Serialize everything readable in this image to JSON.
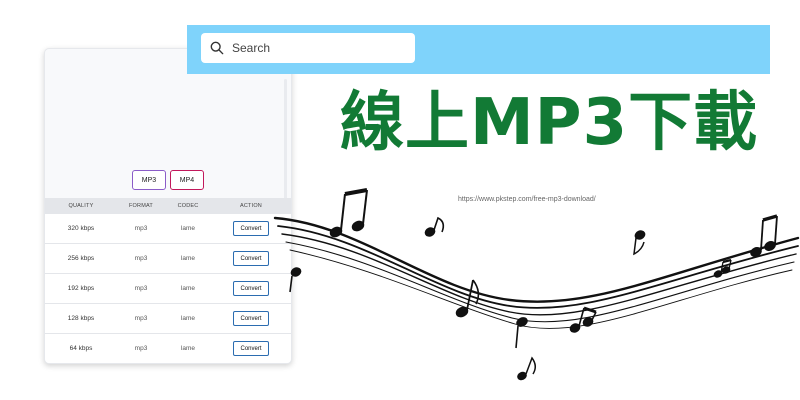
{
  "search": {
    "placeholder": "Search"
  },
  "headline": "線上MP3下載",
  "url": "https://www.pkstep.com/free-mp3-download/",
  "converter": {
    "format_buttons": [
      "MP3",
      "MP4"
    ],
    "columns": [
      "QUALITY",
      "FORMAT",
      "CODEC",
      "ACTION"
    ],
    "rows": [
      {
        "quality": "320 kbps",
        "format": "mp3",
        "codec": "lame",
        "action": "Convert"
      },
      {
        "quality": "256 kbps",
        "format": "mp3",
        "codec": "lame",
        "action": "Convert"
      },
      {
        "quality": "192 kbps",
        "format": "mp3",
        "codec": "lame",
        "action": "Convert"
      },
      {
        "quality": "128 kbps",
        "format": "mp3",
        "codec": "lame",
        "action": "Convert"
      },
      {
        "quality": "64 kbps",
        "format": "mp3",
        "codec": "lame",
        "action": "Convert"
      }
    ]
  },
  "colors": {
    "search_bar": "#7fd3fb",
    "headline": "#127a35",
    "convert_border": "#2b6cb0",
    "mp3_border": "#8b5cc8",
    "mp4_border": "#c2185b"
  },
  "icons": {
    "search": "search-icon",
    "art": "music-notes-illustration"
  }
}
